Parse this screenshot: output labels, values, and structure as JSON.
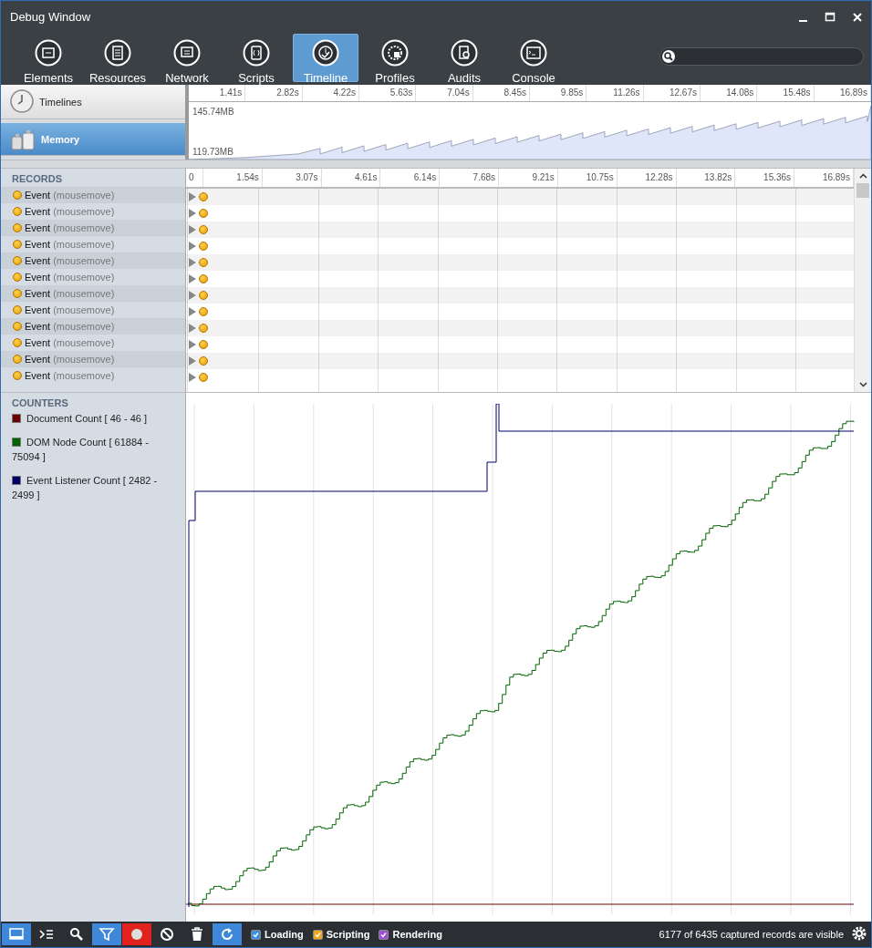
{
  "window": {
    "title": "Debug Window"
  },
  "tabs": [
    {
      "label": "Elements",
      "selected": false
    },
    {
      "label": "Resources",
      "selected": false
    },
    {
      "label": "Network",
      "selected": false
    },
    {
      "label": "Scripts",
      "selected": false
    },
    {
      "label": "Timeline",
      "selected": true
    },
    {
      "label": "Profiles",
      "selected": false
    },
    {
      "label": "Audits",
      "selected": false
    },
    {
      "label": "Console",
      "selected": false
    }
  ],
  "overview": {
    "views": [
      {
        "label": "Timelines",
        "selected": false
      },
      {
        "label": "Memory",
        "selected": true
      }
    ],
    "ruler": [
      "1.41s",
      "2.82s",
      "4.22s",
      "5.63s",
      "7.04s",
      "8.45s",
      "9.85s",
      "11.26s",
      "12.67s",
      "14.08s",
      "15.48s",
      "16.89s"
    ],
    "max_label": "145.74MB",
    "min_label": "119.73MB"
  },
  "records": {
    "heading": "RECORDS",
    "ruler": [
      "0",
      "1.54s",
      "3.07s",
      "4.61s",
      "6.14s",
      "7.68s",
      "9.21s",
      "10.75s",
      "12.28s",
      "13.82s",
      "15.36s",
      "16.89s"
    ],
    "rows": [
      {
        "name": "Event",
        "detail": "(mousemove)"
      },
      {
        "name": "Event",
        "detail": "(mousemove)"
      },
      {
        "name": "Event",
        "detail": "(mousemove)"
      },
      {
        "name": "Event",
        "detail": "(mousemove)"
      },
      {
        "name": "Event",
        "detail": "(mousemove)"
      },
      {
        "name": "Event",
        "detail": "(mousemove)"
      },
      {
        "name": "Event",
        "detail": "(mousemove)"
      },
      {
        "name": "Event",
        "detail": "(mousemove)"
      },
      {
        "name": "Event",
        "detail": "(mousemove)"
      },
      {
        "name": "Event",
        "detail": "(mousemove)"
      },
      {
        "name": "Event",
        "detail": "(mousemove)"
      },
      {
        "name": "Event",
        "detail": "(mousemove)"
      }
    ]
  },
  "counters": {
    "heading": "COUNTERS",
    "items": [
      {
        "label": "Document Count [ 46 - 46 ]",
        "color": "#6b0000"
      },
      {
        "label": "DOM Node Count [ 61884 - 75094 ]",
        "color": "#006400"
      },
      {
        "label": "Event Listener Count [ 2482 - 2499 ]",
        "color": "#000066"
      }
    ]
  },
  "bottom_bar": {
    "buttons": [
      {
        "kind": "dock",
        "on": true
      },
      {
        "kind": "console",
        "on": false
      },
      {
        "kind": "search",
        "on": false
      },
      {
        "kind": "filter",
        "on": true
      },
      {
        "kind": "record",
        "on": false
      },
      {
        "kind": "clear",
        "on": false
      },
      {
        "kind": "trash",
        "on": false
      },
      {
        "kind": "refresh",
        "on": true
      }
    ],
    "filters": [
      {
        "label": "Loading",
        "checked": true,
        "color": "#3d8fe0"
      },
      {
        "label": "Scripting",
        "checked": true,
        "color": "#f0a81c"
      },
      {
        "label": "Rendering",
        "checked": true,
        "color": "#9b4fd6"
      }
    ],
    "status": "6177 of 6435 captured records are visible"
  }
}
